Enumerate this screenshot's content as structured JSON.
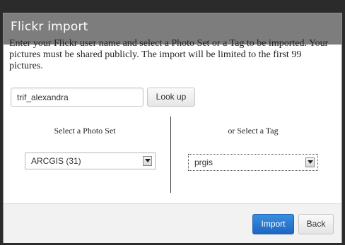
{
  "dialog": {
    "title": "Flickr import",
    "intro": "Enter your Flickr user name and select a Photo Set or a Tag to be imported. Your pictures must be shared publicly. The import will be limited to the first 99 pictures."
  },
  "username": {
    "value": "trif_alexandra"
  },
  "lookup": {
    "label": "Look up"
  },
  "photoset": {
    "label": "Select a Photo Set",
    "selected": "ARCGIS (31)"
  },
  "tag": {
    "label": "or Select a Tag",
    "selected": "prgis"
  },
  "footer": {
    "import_label": "Import",
    "back_label": "Back"
  },
  "colors": {
    "header": "#7d7d7d",
    "primary": "#1e66c1"
  },
  "icons": {
    "dropdown": "chevron-down-icon"
  }
}
